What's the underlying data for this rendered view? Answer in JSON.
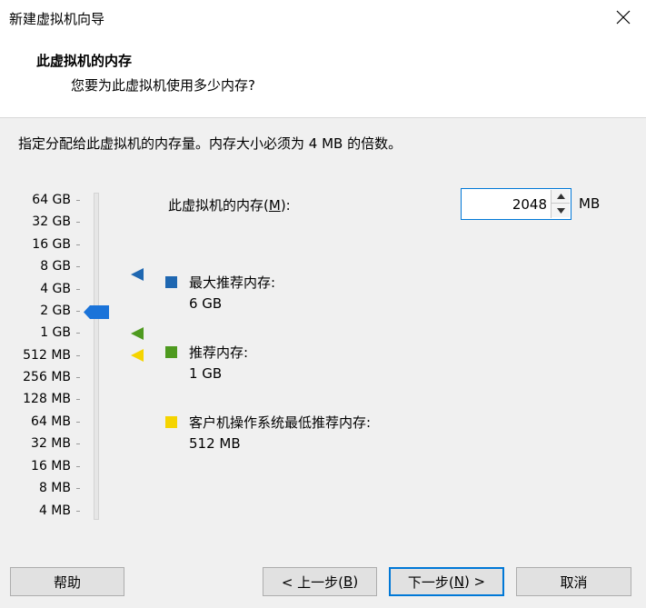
{
  "window": {
    "title": "新建虚拟机向导",
    "close_icon": "close-icon"
  },
  "header": {
    "title": "此虚拟机的内存",
    "subtitle": "您要为此虚拟机使用多少内存?"
  },
  "instructions": "指定分配给此虚拟机的内存量。内存大小必须为 4 MB 的倍数。",
  "memory": {
    "label_prefix": "此虚拟机的内存(",
    "label_hotkey": "M",
    "label_suffix": "):",
    "value": "2048",
    "unit": "MB"
  },
  "scale": {
    "ticks": [
      "64 GB",
      "32 GB",
      "16 GB",
      "8 GB",
      "4 GB",
      "2 GB",
      "1 GB",
      "512 MB",
      "256 MB",
      "128 MB",
      "64 MB",
      "32 MB",
      "16 MB",
      "8 MB",
      "4 MB"
    ],
    "selected": "2 GB"
  },
  "legend": {
    "max": {
      "label": "最大推荐内存:",
      "value": "6 GB",
      "color": "#1f67b1"
    },
    "recommended": {
      "label": "推荐内存:",
      "value": "1 GB",
      "color": "#4e9a1f"
    },
    "guest_min": {
      "label": "客户机操作系统最低推荐内存:",
      "value": "512 MB",
      "color": "#f5d400"
    }
  },
  "buttons": {
    "help": "帮助",
    "back_prefix": "< 上一步(",
    "back_hotkey": "B",
    "back_suffix": ")",
    "next_prefix": "下一步(",
    "next_hotkey": "N",
    "next_suffix": ") >",
    "cancel": "取消"
  },
  "colors": {
    "accent": "#0078d7",
    "thumb": "#1a73d9"
  }
}
